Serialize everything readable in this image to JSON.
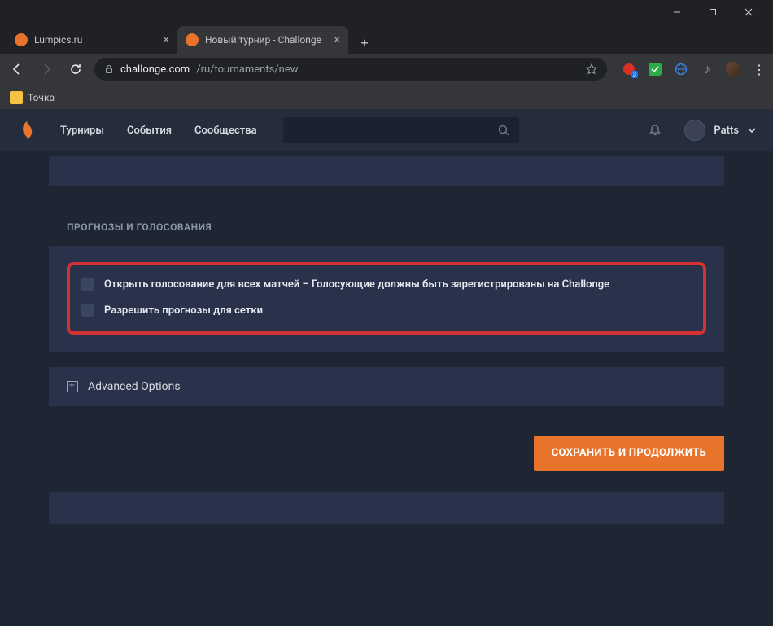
{
  "browser": {
    "tabs": [
      {
        "title": "Lumpics.ru",
        "active": false
      },
      {
        "title": "Новый турнир - Challonge",
        "active": true
      }
    ],
    "url_domain": "challonge.com",
    "url_path": "/ru/tournaments/new",
    "bookmark": "Точка"
  },
  "nav": {
    "links": [
      "Турниры",
      "События",
      "Сообщества"
    ],
    "username": "Patts"
  },
  "section": {
    "title": "ПРОГНОЗЫ И ГОЛОСОВАНИЯ",
    "options": [
      "Открыть голосование для всех матчей – Голосующие должны быть зарегистрированы на Challonge",
      "Разрешить прогнозы для сетки"
    ]
  },
  "advanced_label": "Advanced Options",
  "save_label": "СОХРАНИТЬ И ПРОДОЛЖИТЬ"
}
